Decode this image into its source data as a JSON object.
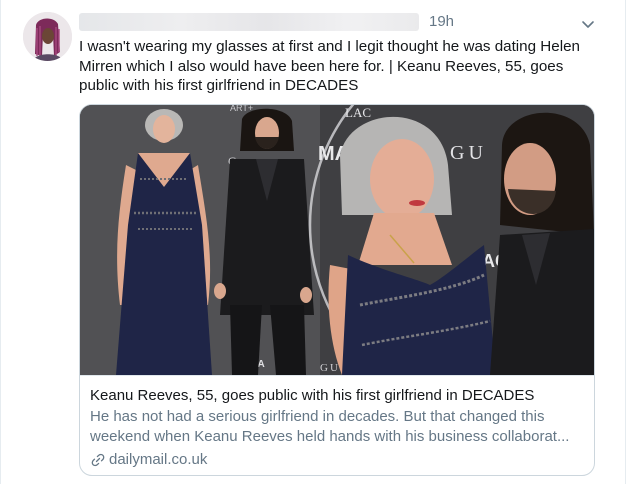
{
  "tweet": {
    "timestamp": "19h",
    "text": "I wasn't wearing my glasses at first and I legit thought he was dating Helen Mirren which I also would have been here for. | Keanu Reeves, 55, goes public with his first girlfriend in DECADES",
    "more_icon": "chevron-down-icon"
  },
  "card": {
    "title": "Keanu Reeves, 55, goes public with his first girlfriend in DECADES",
    "description": "He has not had a serious girlfriend in decades. But that changed this weekend when Keanu Reeves held hands with his business collaborat...",
    "domain": "dailymail.co.uk",
    "domain_icon": "link-icon",
    "image_texts": {
      "art": "ART+",
      "lac_top": "LAC",
      "gu_left": "G",
      "gu_right": "GU",
      "ma": "MA",
      "ac": "AC",
      "cma": "CMA",
      "gucci_bottom": "GUCC"
    }
  },
  "colors": {
    "text_primary": "#14171a",
    "text_secondary": "#657786",
    "border": "#ccd6dd",
    "dress_navy": "#1f2547",
    "suit_black": "#1b1b1d",
    "backdrop": "#4b4b4e"
  }
}
